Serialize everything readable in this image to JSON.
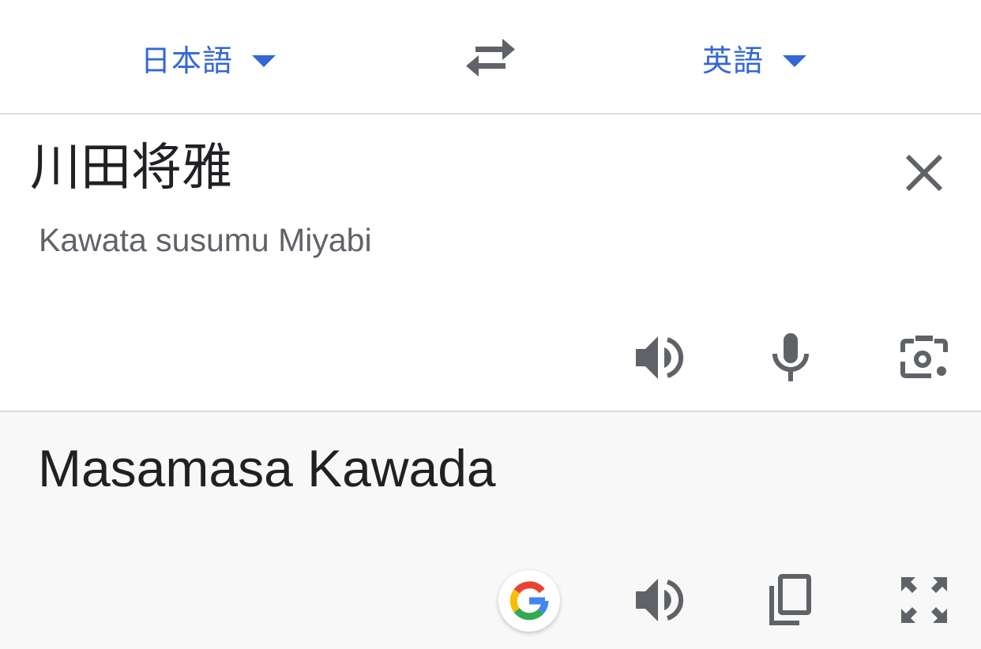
{
  "language_bar": {
    "source_language": "日本語",
    "target_language": "英語"
  },
  "source": {
    "text": "川田将雅",
    "romanization": "Kawata susumu Miyabi"
  },
  "target": {
    "text": "Masamasa Kawada"
  },
  "icons": {
    "swap": "swap-arrows-icon",
    "clear": "close-icon",
    "listen": "speaker-icon",
    "voice": "microphone-icon",
    "camera": "camera-icon",
    "google": "google-g-icon",
    "copy": "copy-icon",
    "fullscreen": "fullscreen-icon"
  },
  "colors": {
    "accent": "#3367d6",
    "icon": "#5f6368",
    "text": "#202124",
    "target_background": "#f8f8f8"
  }
}
